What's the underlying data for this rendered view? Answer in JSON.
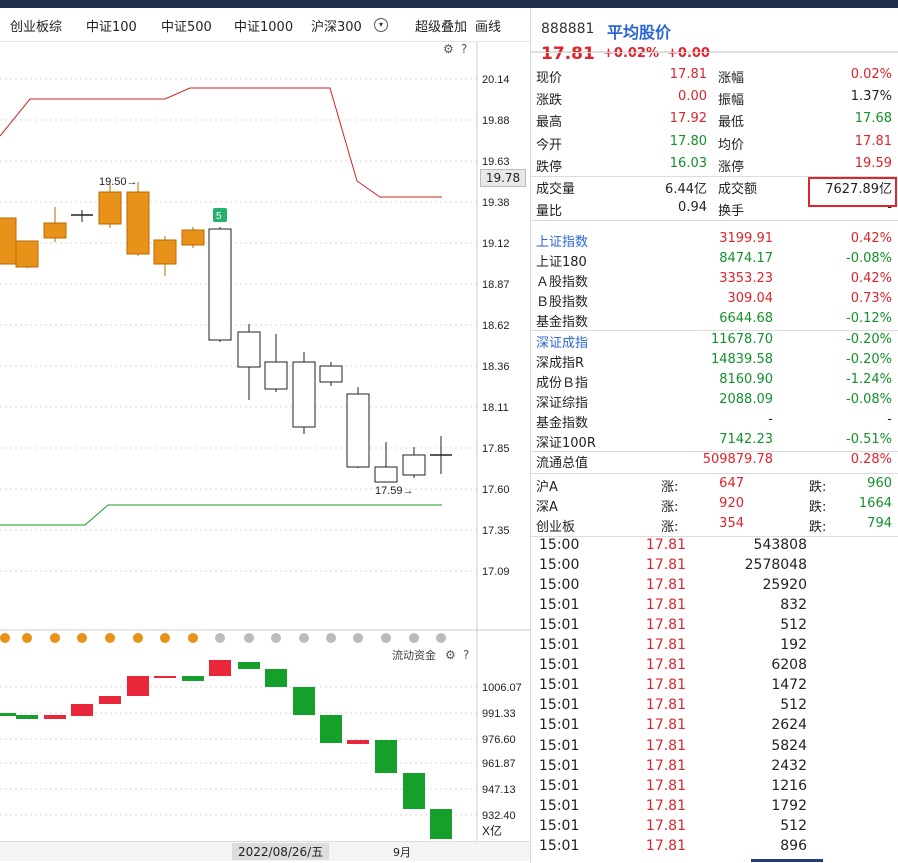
{
  "tabs": [
    "创业板综",
    "中证100",
    "中证500",
    "中证1000",
    "沪深300",
    "超级叠加",
    "画线"
  ],
  "price_axis": [
    "20.14",
    "19.88",
    "19.63",
    "19.38",
    "19.12",
    "18.87",
    "18.62",
    "18.36",
    "18.11",
    "17.85",
    "17.60",
    "17.35",
    "17.09"
  ],
  "current_price_tag": "19.78",
  "annotations": {
    "high": "19.50→",
    "low": "17.59→",
    "marker": "5"
  },
  "flow": {
    "title": "流动资金",
    "axis": [
      "1006.07",
      "991.33",
      "976.60",
      "961.87",
      "947.13",
      "932.40"
    ],
    "unit": "X亿"
  },
  "date_axis": {
    "selected": "2022/08/26/五",
    "month": "9月"
  },
  "stock": {
    "code": "888881",
    "name": "平均股价",
    "price": "17.81",
    "pct": "+0.02%",
    "chg": "+0.00"
  },
  "quote_rows": [
    {
      "l1": "现价",
      "v1": "17.81",
      "c1": "red",
      "l2": "涨幅",
      "v2": "0.02%",
      "c2": "red"
    },
    {
      "l1": "涨跌",
      "v1": "0.00",
      "c1": "red",
      "l2": "振幅",
      "v2": "1.37%",
      "c2": "black"
    },
    {
      "l1": "最高",
      "v1": "17.92",
      "c1": "red",
      "l2": "最低",
      "v2": "17.68",
      "c2": "green"
    },
    {
      "l1": "今开",
      "v1": "17.80",
      "c1": "green",
      "l2": "均价",
      "v2": "17.81",
      "c2": "red"
    },
    {
      "l1": "跌停",
      "v1": "16.03",
      "c1": "green",
      "l2": "涨停",
      "v2": "19.59",
      "c2": "red"
    },
    {
      "l1": "成交量",
      "v1": "6.44亿",
      "c1": "black",
      "l2": "成交额",
      "v2": "7627.89亿",
      "c2": "black"
    },
    {
      "l1": "量比",
      "v1": "0.94",
      "c1": "black",
      "l2": "换手",
      "v2": "-",
      "c2": "black"
    }
  ],
  "indices": [
    {
      "name": "上证指数",
      "val": "3199.91",
      "vc": "red",
      "pct": "0.42%",
      "pc": "red",
      "nc": "blue"
    },
    {
      "name": "上证180",
      "val": "8474.17",
      "vc": "green",
      "pct": "-0.08%",
      "pc": "green",
      "nc": "black"
    },
    {
      "name": "Ａ股指数",
      "val": "3353.23",
      "vc": "red",
      "pct": "0.42%",
      "pc": "red",
      "nc": "black"
    },
    {
      "name": "Ｂ股指数",
      "val": "309.04",
      "vc": "red",
      "pct": "0.73%",
      "pc": "red",
      "nc": "black"
    },
    {
      "name": "基金指数",
      "val": "6644.68",
      "vc": "green",
      "pct": "-0.12%",
      "pc": "green",
      "nc": "black"
    },
    {
      "name": "深证成指",
      "val": "11678.70",
      "vc": "green",
      "pct": "-0.20%",
      "pc": "green",
      "nc": "blue"
    },
    {
      "name": "深成指R",
      "val": "14839.58",
      "vc": "green",
      "pct": "-0.20%",
      "pc": "green",
      "nc": "black"
    },
    {
      "name": "成份Ｂ指",
      "val": "8160.90",
      "vc": "green",
      "pct": "-1.24%",
      "pc": "green",
      "nc": "black"
    },
    {
      "name": "深证综指",
      "val": "2088.09",
      "vc": "green",
      "pct": "-0.08%",
      "pc": "green",
      "nc": "black"
    },
    {
      "name": "基金指数",
      "val": "-",
      "vc": "black",
      "pct": "-",
      "pc": "black",
      "nc": "black"
    },
    {
      "name": "深证100R",
      "val": "7142.23",
      "vc": "green",
      "pct": "-0.51%",
      "pc": "green",
      "nc": "black"
    },
    {
      "name": "流通总值",
      "val": "509879.78",
      "vc": "red",
      "pct": "0.28%",
      "pc": "red",
      "nc": "black"
    }
  ],
  "breadth": [
    {
      "name": "沪A",
      "up_label": "涨:",
      "up": "647",
      "down_label": "跌:",
      "down": "960"
    },
    {
      "name": "深A",
      "up_label": "涨:",
      "up": "920",
      "down_label": "跌:",
      "down": "1664"
    },
    {
      "name": "创业板",
      "up_label": "涨:",
      "up": "354",
      "down_label": "跌:",
      "down": "794"
    }
  ],
  "ticks": [
    {
      "t": "15:00",
      "p": "17.81",
      "v": "543808"
    },
    {
      "t": "15:00",
      "p": "17.81",
      "v": "2578048"
    },
    {
      "t": "15:00",
      "p": "17.81",
      "v": "25920"
    },
    {
      "t": "15:01",
      "p": "17.81",
      "v": "832"
    },
    {
      "t": "15:01",
      "p": "17.81",
      "v": "512"
    },
    {
      "t": "15:01",
      "p": "17.81",
      "v": "192"
    },
    {
      "t": "15:01",
      "p": "17.81",
      "v": "6208"
    },
    {
      "t": "15:01",
      "p": "17.81",
      "v": "1472"
    },
    {
      "t": "15:01",
      "p": "17.81",
      "v": "512"
    },
    {
      "t": "15:01",
      "p": "17.81",
      "v": "2624"
    },
    {
      "t": "15:01",
      "p": "17.81",
      "v": "5824"
    },
    {
      "t": "15:01",
      "p": "17.81",
      "v": "2432"
    },
    {
      "t": "15:01",
      "p": "17.81",
      "v": "1216"
    },
    {
      "t": "15:01",
      "p": "17.81",
      "v": "1792"
    },
    {
      "t": "15:01",
      "p": "17.81",
      "v": "512"
    },
    {
      "t": "15:01",
      "p": "17.81",
      "v": "896"
    }
  ],
  "colors": {
    "up": "#e0232c",
    "down": "#13912b",
    "candle_up": "#e8921a",
    "flow_up": "#e8283a",
    "flow_down": "#14a02a"
  }
}
